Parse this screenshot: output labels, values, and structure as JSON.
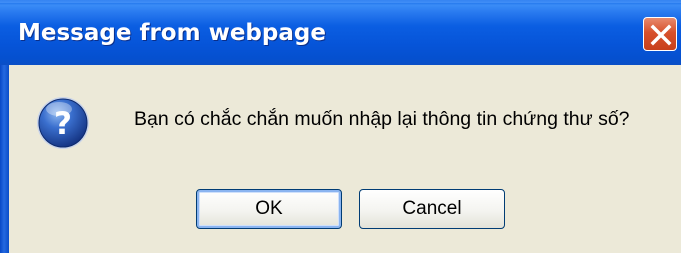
{
  "dialog": {
    "title": "Message from webpage",
    "message": "Bạn có chắc chắn muốn nhập lại thông tin chứng thư số?",
    "icon": "question-icon",
    "buttons": {
      "ok_label": "OK",
      "cancel_label": "Cancel"
    },
    "close_icon": "close-icon"
  },
  "colors": {
    "titlebar": "#0654d8",
    "body": "#ece9d8",
    "close_button": "#d7502c",
    "button_border": "#003c74"
  }
}
